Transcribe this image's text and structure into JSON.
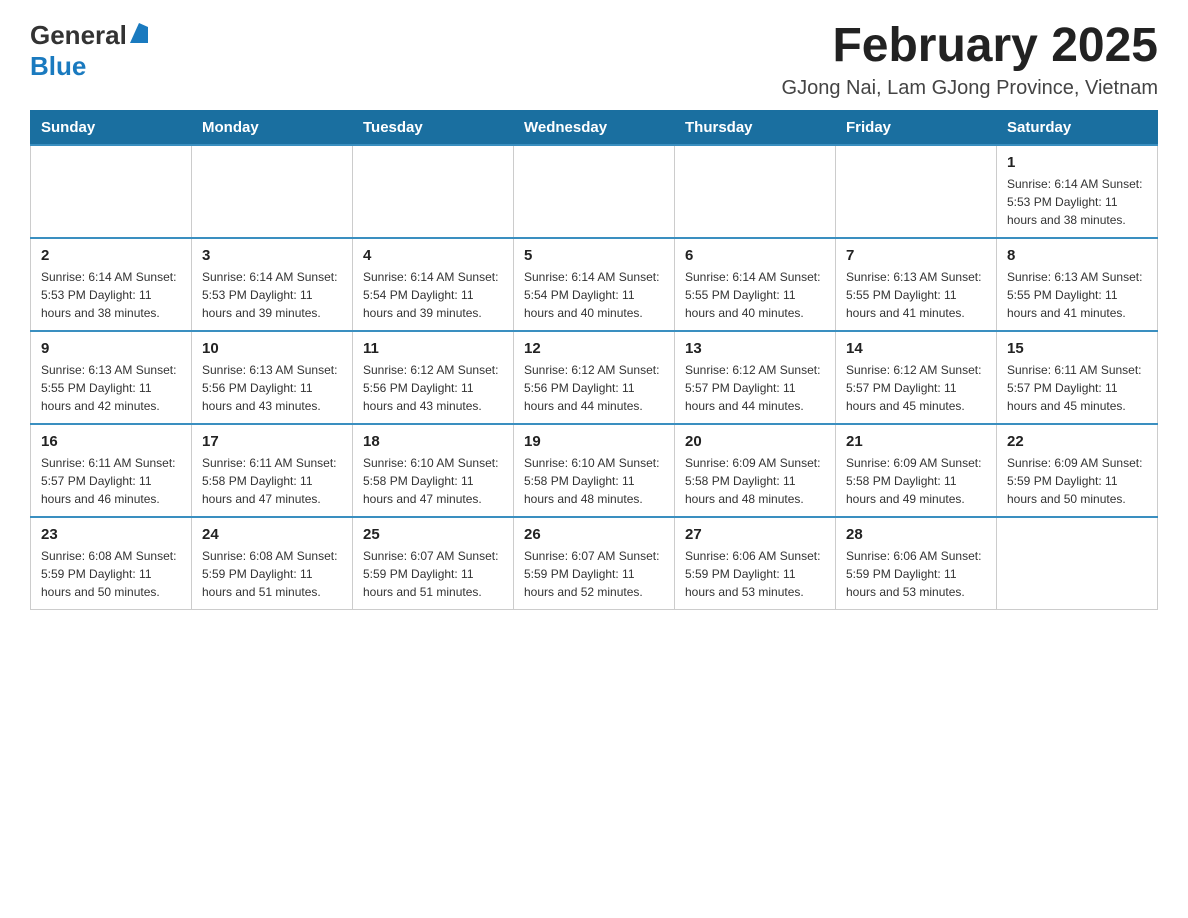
{
  "header": {
    "logo_general": "General",
    "logo_blue": "Blue",
    "month_year": "February 2025",
    "location": "GJong Nai, Lam GJong Province, Vietnam"
  },
  "days_of_week": [
    "Sunday",
    "Monday",
    "Tuesday",
    "Wednesday",
    "Thursday",
    "Friday",
    "Saturday"
  ],
  "weeks": [
    [
      {
        "day": "",
        "info": ""
      },
      {
        "day": "",
        "info": ""
      },
      {
        "day": "",
        "info": ""
      },
      {
        "day": "",
        "info": ""
      },
      {
        "day": "",
        "info": ""
      },
      {
        "day": "",
        "info": ""
      },
      {
        "day": "1",
        "info": "Sunrise: 6:14 AM\nSunset: 5:53 PM\nDaylight: 11 hours and 38 minutes."
      }
    ],
    [
      {
        "day": "2",
        "info": "Sunrise: 6:14 AM\nSunset: 5:53 PM\nDaylight: 11 hours and 38 minutes."
      },
      {
        "day": "3",
        "info": "Sunrise: 6:14 AM\nSunset: 5:53 PM\nDaylight: 11 hours and 39 minutes."
      },
      {
        "day": "4",
        "info": "Sunrise: 6:14 AM\nSunset: 5:54 PM\nDaylight: 11 hours and 39 minutes."
      },
      {
        "day": "5",
        "info": "Sunrise: 6:14 AM\nSunset: 5:54 PM\nDaylight: 11 hours and 40 minutes."
      },
      {
        "day": "6",
        "info": "Sunrise: 6:14 AM\nSunset: 5:55 PM\nDaylight: 11 hours and 40 minutes."
      },
      {
        "day": "7",
        "info": "Sunrise: 6:13 AM\nSunset: 5:55 PM\nDaylight: 11 hours and 41 minutes."
      },
      {
        "day": "8",
        "info": "Sunrise: 6:13 AM\nSunset: 5:55 PM\nDaylight: 11 hours and 41 minutes."
      }
    ],
    [
      {
        "day": "9",
        "info": "Sunrise: 6:13 AM\nSunset: 5:55 PM\nDaylight: 11 hours and 42 minutes."
      },
      {
        "day": "10",
        "info": "Sunrise: 6:13 AM\nSunset: 5:56 PM\nDaylight: 11 hours and 43 minutes."
      },
      {
        "day": "11",
        "info": "Sunrise: 6:12 AM\nSunset: 5:56 PM\nDaylight: 11 hours and 43 minutes."
      },
      {
        "day": "12",
        "info": "Sunrise: 6:12 AM\nSunset: 5:56 PM\nDaylight: 11 hours and 44 minutes."
      },
      {
        "day": "13",
        "info": "Sunrise: 6:12 AM\nSunset: 5:57 PM\nDaylight: 11 hours and 44 minutes."
      },
      {
        "day": "14",
        "info": "Sunrise: 6:12 AM\nSunset: 5:57 PM\nDaylight: 11 hours and 45 minutes."
      },
      {
        "day": "15",
        "info": "Sunrise: 6:11 AM\nSunset: 5:57 PM\nDaylight: 11 hours and 45 minutes."
      }
    ],
    [
      {
        "day": "16",
        "info": "Sunrise: 6:11 AM\nSunset: 5:57 PM\nDaylight: 11 hours and 46 minutes."
      },
      {
        "day": "17",
        "info": "Sunrise: 6:11 AM\nSunset: 5:58 PM\nDaylight: 11 hours and 47 minutes."
      },
      {
        "day": "18",
        "info": "Sunrise: 6:10 AM\nSunset: 5:58 PM\nDaylight: 11 hours and 47 minutes."
      },
      {
        "day": "19",
        "info": "Sunrise: 6:10 AM\nSunset: 5:58 PM\nDaylight: 11 hours and 48 minutes."
      },
      {
        "day": "20",
        "info": "Sunrise: 6:09 AM\nSunset: 5:58 PM\nDaylight: 11 hours and 48 minutes."
      },
      {
        "day": "21",
        "info": "Sunrise: 6:09 AM\nSunset: 5:58 PM\nDaylight: 11 hours and 49 minutes."
      },
      {
        "day": "22",
        "info": "Sunrise: 6:09 AM\nSunset: 5:59 PM\nDaylight: 11 hours and 50 minutes."
      }
    ],
    [
      {
        "day": "23",
        "info": "Sunrise: 6:08 AM\nSunset: 5:59 PM\nDaylight: 11 hours and 50 minutes."
      },
      {
        "day": "24",
        "info": "Sunrise: 6:08 AM\nSunset: 5:59 PM\nDaylight: 11 hours and 51 minutes."
      },
      {
        "day": "25",
        "info": "Sunrise: 6:07 AM\nSunset: 5:59 PM\nDaylight: 11 hours and 51 minutes."
      },
      {
        "day": "26",
        "info": "Sunrise: 6:07 AM\nSunset: 5:59 PM\nDaylight: 11 hours and 52 minutes."
      },
      {
        "day": "27",
        "info": "Sunrise: 6:06 AM\nSunset: 5:59 PM\nDaylight: 11 hours and 53 minutes."
      },
      {
        "day": "28",
        "info": "Sunrise: 6:06 AM\nSunset: 5:59 PM\nDaylight: 11 hours and 53 minutes."
      },
      {
        "day": "",
        "info": ""
      }
    ]
  ]
}
